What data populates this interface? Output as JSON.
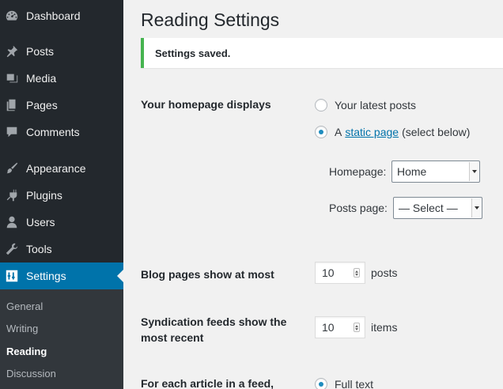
{
  "sidebar": {
    "items": [
      {
        "label": "Dashboard",
        "icon": "dashboard-icon"
      },
      {
        "label": "Posts",
        "icon": "pin-icon"
      },
      {
        "label": "Media",
        "icon": "media-icon"
      },
      {
        "label": "Pages",
        "icon": "pages-icon"
      },
      {
        "label": "Comments",
        "icon": "comment-icon"
      },
      {
        "label": "Appearance",
        "icon": "brush-icon"
      },
      {
        "label": "Plugins",
        "icon": "plugin-icon"
      },
      {
        "label": "Users",
        "icon": "user-icon"
      },
      {
        "label": "Tools",
        "icon": "wrench-icon"
      },
      {
        "label": "Settings",
        "icon": "settings-icon"
      }
    ],
    "submenu": [
      "General",
      "Writing",
      "Reading",
      "Discussion"
    ]
  },
  "main": {
    "title": "Reading Settings",
    "notice": "Settings saved.",
    "homepage_displays": {
      "label": "Your homepage displays",
      "option_latest": "Your latest posts",
      "option_static_prefix": "A",
      "option_static_link": "static page",
      "option_static_suffix": "(select below)",
      "homepage_label": "Homepage:",
      "homepage_value": "Home",
      "posts_page_label": "Posts page:",
      "posts_page_value": "— Select —"
    },
    "blog_pages": {
      "label": "Blog pages show at most",
      "value": "10",
      "unit": "posts"
    },
    "syndication": {
      "label_line1": "Syndication feeds show the",
      "label_line2": "most recent",
      "value": "10",
      "unit": "items"
    },
    "feed_article": {
      "label": "For each article in a feed,",
      "option_full": "Full text"
    }
  },
  "colors": {
    "sidebar_bg": "#23282d",
    "active_bg": "#0073aa",
    "notice_border": "#46b450",
    "link": "#0073aa"
  }
}
